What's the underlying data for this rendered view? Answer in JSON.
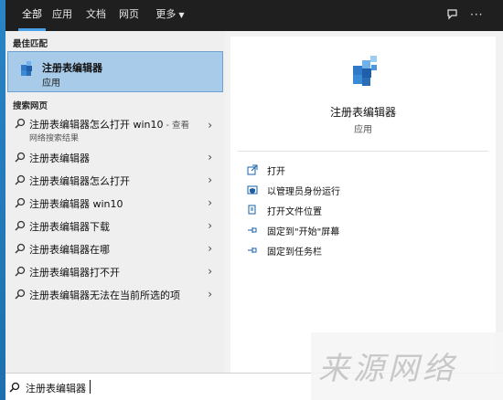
{
  "tabs": [
    {
      "label": "全部",
      "active": true
    },
    {
      "label": "应用",
      "active": false
    },
    {
      "label": "文档",
      "active": false
    },
    {
      "label": "网页",
      "active": false
    },
    {
      "label": "更多",
      "active": false
    }
  ],
  "topbar": {
    "feedback_icon": "feedback-icon",
    "more_icon": "ellipsis-icon",
    "more_glyph": "···"
  },
  "best_match": {
    "section_label": "最佳匹配",
    "title": "注册表编辑器",
    "subtitle": "应用",
    "icon": "registry-editor-icon"
  },
  "web": {
    "section_label": "搜索网页",
    "results": [
      {
        "text": "注册表编辑器怎么打开 win10",
        "suffix": " - 查看",
        "sub": "网络搜索结果"
      },
      {
        "text": "注册表编辑器"
      },
      {
        "text": "注册表编辑器怎么打开"
      },
      {
        "text": "注册表编辑器 win10"
      },
      {
        "text": "注册表编辑器下载"
      },
      {
        "text": "注册表编辑器在哪"
      },
      {
        "text": "注册表编辑器打不开"
      },
      {
        "text": "注册表编辑器无法在当前所选的项"
      }
    ]
  },
  "preview": {
    "title": "注册表编辑器",
    "subtitle": "应用",
    "actions": [
      {
        "label": "打开",
        "icon": "open-icon"
      },
      {
        "label": "以管理员身份运行",
        "icon": "shield-icon"
      },
      {
        "label": "打开文件位置",
        "icon": "folder-icon"
      },
      {
        "label": "固定到\"开始\"屏幕",
        "icon": "pin-icon"
      },
      {
        "label": "固定到任务栏",
        "icon": "pin-icon"
      }
    ]
  },
  "search": {
    "value": "注册表编辑器"
  },
  "watermark": {
    "text": "来源网络"
  },
  "colors": {
    "accent": "#4aa0e6",
    "selected_bg": "#a8cbe9",
    "topbar_bg": "#1f1f1f"
  }
}
